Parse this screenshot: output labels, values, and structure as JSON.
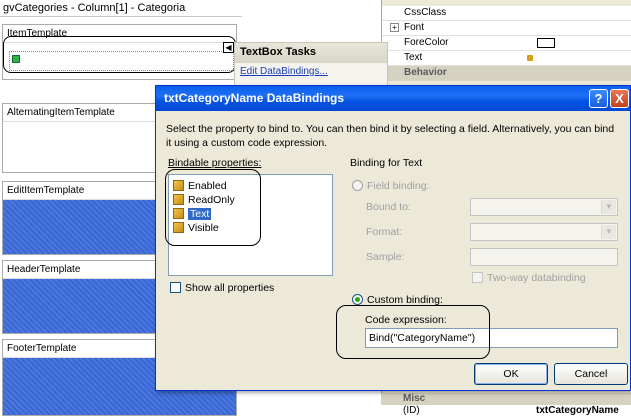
{
  "designer": {
    "title": "gvCategories - Column[1] - Categoria",
    "templates": [
      {
        "label": "ItemTemplate"
      },
      {
        "label": "AlternatingItemTemplate"
      },
      {
        "label": "EditItemTemplate"
      },
      {
        "label": "HeaderTemplate"
      },
      {
        "label": "FooterTemplate"
      }
    ]
  },
  "tasks": {
    "header": "TextBox Tasks",
    "link": "Edit DataBindings..."
  },
  "properties": {
    "rows": [
      "CssClass",
      "Font",
      "ForeColor",
      "Text"
    ],
    "category_behavior": "Behavior",
    "category_misc": "Misc",
    "id_name": "(ID)",
    "id_value": "txtCategoryName"
  },
  "dialog": {
    "title": "txtCategoryName DataBindings",
    "description": "Select the property to bind to. You can then bind it by selecting a field. Alternatively, you can bind it using a custom code expression.",
    "bindable_label": "Bindable properties:",
    "bindable_items": [
      "Enabled",
      "ReadOnly",
      "Text",
      "Visible"
    ],
    "selected_item": "Text",
    "show_all": "Show all properties",
    "binding_for": "Binding for Text",
    "field_binding": "Field binding:",
    "bound_to": "Bound to:",
    "format": "Format:",
    "sample": "Sample:",
    "two_way": "Two-way databinding",
    "custom_binding": "Custom binding:",
    "code_expression_label": "Code expression:",
    "code_expression_value": "Bind(\"CategoryName\")",
    "ok": "OK",
    "cancel": "Cancel",
    "help": "?",
    "close": "X"
  }
}
